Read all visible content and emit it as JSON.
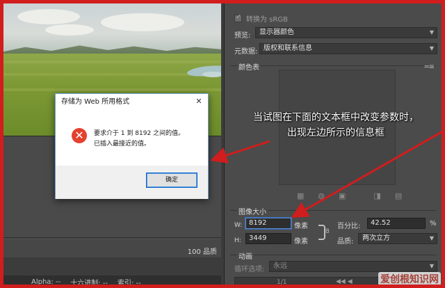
{
  "dialog": {
    "title": "存储为 Web 所用格式",
    "close_glyph": "✕",
    "message_line1": "要求介于 1 到 8192 之间的值。",
    "message_line2": "已插入最接近的值。",
    "ok_label": "确定",
    "error_glyph": "✕"
  },
  "left_panel": {
    "quality": "100 品质"
  },
  "status_bar": {
    "alpha": "Alpha: --",
    "hex": "十六进制: --",
    "index": "索引: --"
  },
  "right_panel": {
    "convert_srgb": "转换为 sRGB",
    "convert_srgb_checked": true,
    "preview_label": "预览:",
    "preview_value": "显示器颜色",
    "metadata_label": "元数据:",
    "metadata_value": "版权和联系信息",
    "color_table_title": "颜色表",
    "image_size_title": "图像大小",
    "width_label": "W:",
    "width_value": "8192",
    "width_unit": "像素",
    "height_label": "H:",
    "height_value": "3449",
    "height_unit": "像素",
    "percent_label": "百分比:",
    "percent_value": "42.52",
    "percent_unit": "%",
    "quality_label": "品质:",
    "quality_value": "两次立方",
    "animation_title": "动画",
    "loop_label": "循环选项:",
    "loop_value": "永远",
    "frame_counter": "1/1"
  },
  "annotation": {
    "line1": "当试图在下面的文本框中改变参数时，",
    "line2": "出现左边所示的信息框",
    "arrow_color": "#d11d1d"
  },
  "watermark": "爱创根知识网",
  "colors": {
    "frame_red": "#d11d1d",
    "panel_dark": "#4b4b4b",
    "focus_blue": "#5a84c3",
    "error_red": "#e4412f"
  }
}
